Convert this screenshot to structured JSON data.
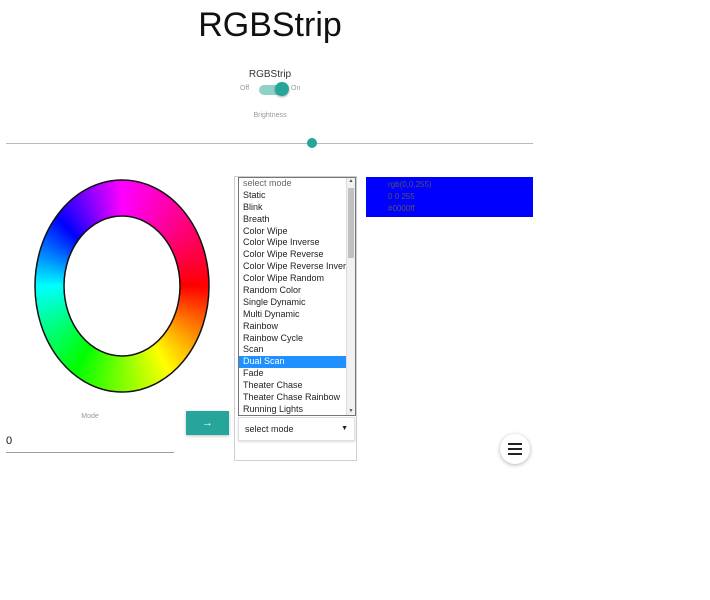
{
  "header": {
    "title": "RGBStrip"
  },
  "power": {
    "label": "RGBStrip",
    "off_label": "Off",
    "on_label": "On",
    "state": "on"
  },
  "brightness": {
    "label": "Brightness",
    "value_percent": 58
  },
  "color_wheel": {
    "icon": "color-wheel"
  },
  "mode": {
    "label": "Mode",
    "value": "0",
    "go_label": "→"
  },
  "mode_dropdown": {
    "options": [
      "select mode",
      "Static",
      "Blink",
      "Breath",
      "Color Wipe",
      "Color Wipe Inverse",
      "Color Wipe Reverse",
      "Color Wipe Reverse Inverse",
      "Color Wipe Random",
      "Random Color",
      "Single Dynamic",
      "Multi Dynamic",
      "Rainbow",
      "Rainbow Cycle",
      "Scan",
      "Dual Scan",
      "Fade",
      "Theater Chase",
      "Theater Chase Rainbow",
      "Running Lights"
    ],
    "highlighted": "Dual Scan",
    "selected_label": "select mode",
    "caret_icon": "caret-down-icon"
  },
  "color_panel": {
    "color": "#0000ff",
    "lines": [
      "rgb(0,0,255)",
      "0 0 255",
      "#0000ff"
    ]
  },
  "menu_button": {
    "icon": "hamburger-menu-icon"
  },
  "colors": {
    "accent": "#26a69a",
    "accent_light": "#8fd1c7",
    "highlight": "#1e90ff"
  }
}
